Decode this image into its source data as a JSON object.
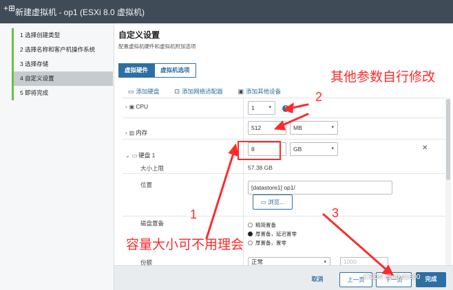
{
  "window": {
    "title": "新建虚拟机 - op1 (ESXi 8.0 虚拟机)"
  },
  "steps": [
    {
      "label": "1  选择创建类型"
    },
    {
      "label": "2  选择名称和客户机操作系统"
    },
    {
      "label": "3  选择存储"
    },
    {
      "label": "4  自定义设置"
    },
    {
      "label": "5  即将完成"
    }
  ],
  "page": {
    "title": "自定义设置",
    "subtitle": "配置虚拟机硬件和虚拟机附加选项"
  },
  "tabs": [
    {
      "label": "虚拟硬件"
    },
    {
      "label": "虚拟机选项"
    }
  ],
  "toolbar": {
    "add_disk": "添加硬盘",
    "add_nic": "添加网络适配器",
    "add_other": "添加其他设备"
  },
  "cpu": {
    "label": "CPU",
    "value": "1",
    "info": "!"
  },
  "memory": {
    "label": "内存",
    "value": "512",
    "unit": "MB"
  },
  "disk": {
    "label": "硬盘 1",
    "value": "8",
    "unit": "GB",
    "max_label": "大小上限",
    "max_value": "57.38 GB",
    "location_label": "位置",
    "location_value": "[datastore1] op1/",
    "browse_label": "浏览...",
    "provisioning_label": "磁盘置备",
    "provisioning_options": [
      "精简置备",
      "厚置备，延迟置零",
      "厚置备，置零"
    ],
    "shares_label": "份额",
    "shares_value": "正常",
    "shares_amount": "1000"
  },
  "footer": {
    "cancel": "取消",
    "back": "上一页",
    "next": "下一页",
    "finish": "完成"
  },
  "annotations": {
    "other_params": "其他参数自行修改",
    "n1": "1",
    "n2": "2",
    "n3": "3",
    "capacity_note": "容量大小可不用理会"
  },
  "watermark": "CSDN @nfkd1600",
  "colors": {
    "accent": "#2d6fa4",
    "step_bar": "#6dbf3b",
    "annotation": "#ff2a2a",
    "titlebar": "#404b58"
  }
}
